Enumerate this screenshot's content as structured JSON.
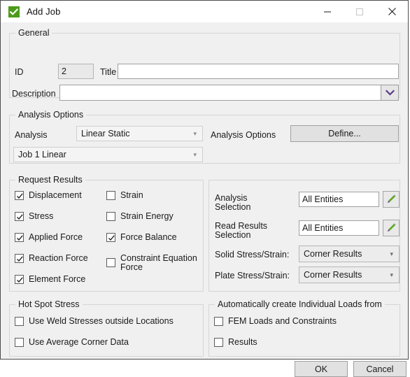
{
  "window": {
    "title": "Add Job",
    "icon": "green-check-icon",
    "minimize_label": "Minimize",
    "maximize_label": "Maximize",
    "close_label": "Close",
    "accent_green": "#4d9b19",
    "background": "#f0f0f0"
  },
  "general": {
    "group_title": "General",
    "id_label": "ID",
    "id_value": "2",
    "title_label": "Title",
    "title_value": "",
    "title_placeholder": "",
    "description_label": "Description",
    "description_value": "",
    "description_placeholder": "",
    "description_dropdown_icon": "chevron-down-icon"
  },
  "analysis_options": {
    "group_title": "Analysis Options",
    "analysis_label": "Analysis",
    "analysis_value": "Linear Static",
    "job_value": "Job 1 Linear",
    "options_label": "Analysis Options",
    "define_button": "Define..."
  },
  "request_results": {
    "group_title": "Request Results",
    "left_column": [
      {
        "label": "Displacement",
        "checked": true
      },
      {
        "label": "Stress",
        "checked": true
      },
      {
        "label": "Applied Force",
        "checked": true
      },
      {
        "label": "Reaction Force",
        "checked": true
      },
      {
        "label": "Element Force",
        "checked": true
      }
    ],
    "right_column": [
      {
        "label": "Strain",
        "checked": false
      },
      {
        "label": "Strain Energy",
        "checked": false
      },
      {
        "label": "Force Balance",
        "checked": true
      },
      {
        "label": "Constraint Equation Force",
        "checked": false
      }
    ]
  },
  "selection_panel": {
    "analysis_selection_label": "Analysis Selection",
    "analysis_selection_value": "All Entities",
    "analysis_selection_edit_icon": "pencil-icon",
    "read_results_selection_label": "Read Results Selection",
    "read_results_selection_value": "All Entities",
    "read_results_selection_edit_icon": "pencil-icon",
    "solid_label": "Solid Stress/Strain:",
    "solid_value": "Corner Results",
    "plate_label": "Plate Stress/Strain:",
    "plate_value": "Corner Results",
    "dropdown_icon": "chevron-down-icon"
  },
  "hot_spot_stress": {
    "group_title": "Hot Spot Stress",
    "items": [
      {
        "label": "Use Weld Stresses outside Locations",
        "checked": false
      },
      {
        "label": "Use Average Corner Data",
        "checked": false
      }
    ]
  },
  "individual_loads": {
    "group_title": "Automatically create Individual Loads from",
    "items": [
      {
        "label": "FEM Loads and Constraints",
        "checked": false
      },
      {
        "label": "Results",
        "checked": false
      }
    ]
  },
  "footer": {
    "ok_label": "OK",
    "cancel_label": "Cancel"
  }
}
